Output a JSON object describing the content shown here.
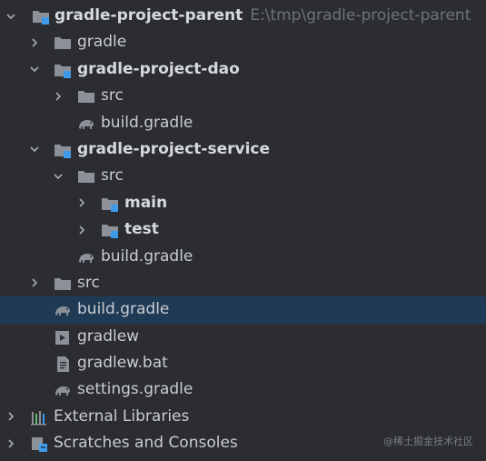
{
  "tree": {
    "root": {
      "label": "gradle-project-parent",
      "path": "E:\\tmp\\gradle-project-parent"
    },
    "gradle_dir": {
      "label": "gradle"
    },
    "dao": {
      "label": "gradle-project-dao"
    },
    "dao_src": {
      "label": "src"
    },
    "dao_build": {
      "label": "build.gradle"
    },
    "service": {
      "label": "gradle-project-service"
    },
    "service_src": {
      "label": "src"
    },
    "main": {
      "label": "main"
    },
    "test": {
      "label": "test"
    },
    "service_build": {
      "label": "build.gradle"
    },
    "root_src": {
      "label": "src"
    },
    "root_build": {
      "label": "build.gradle"
    },
    "gradlew": {
      "label": "gradlew"
    },
    "gradlew_bat": {
      "label": "gradlew.bat"
    },
    "settings": {
      "label": "settings.gradle"
    },
    "external_libraries": {
      "label": "External Libraries"
    },
    "scratches": {
      "label": "Scratches and Consoles"
    }
  },
  "watermark": "@稀土掘金技术社区",
  "colors": {
    "background": "#2b2d30",
    "selection": "#1e3a55",
    "folder": "#8c9199",
    "module_badge": "#3d9be9",
    "path_text": "#6f737a"
  }
}
